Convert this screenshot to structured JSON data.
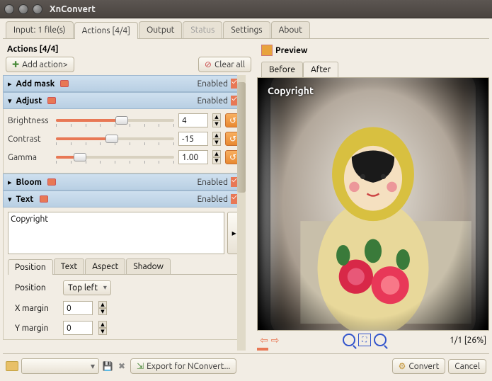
{
  "title": "XnConvert",
  "tabs": {
    "input": "Input: 1 file(s)",
    "actions": "Actions [4/4]",
    "output": "Output",
    "status": "Status",
    "settings": "Settings",
    "about": "About"
  },
  "left": {
    "heading": "Actions [4/4]",
    "add_action": "Add action>",
    "clear_all": "Clear all",
    "enabled_label": "Enabled",
    "items": {
      "add_mask": {
        "title": "Add mask"
      },
      "adjust": {
        "title": "Adjust",
        "brightness_label": "Brightness",
        "brightness_value": "4",
        "contrast_label": "Contrast",
        "contrast_value": "-15",
        "gamma_label": "Gamma",
        "gamma_value": "1.00"
      },
      "bloom": {
        "title": "Bloom"
      },
      "text": {
        "title": "Text",
        "content": "Copyright",
        "subtabs": {
          "position": "Position",
          "text": "Text",
          "aspect": "Aspect",
          "shadow": "Shadow"
        },
        "position_label": "Position",
        "position_value": "Top left",
        "x_margin_label": "X margin",
        "x_margin_value": "0",
        "y_margin_label": "Y margin",
        "y_margin_value": "0"
      }
    }
  },
  "preview": {
    "heading": "Preview",
    "before_tab": "Before",
    "after_tab": "After",
    "watermark_text": "Copyright",
    "status": "1/1 [26%]"
  },
  "bottom": {
    "export_label": "Export for NConvert...",
    "convert_label": "Convert",
    "cancel_label": "Cancel"
  }
}
